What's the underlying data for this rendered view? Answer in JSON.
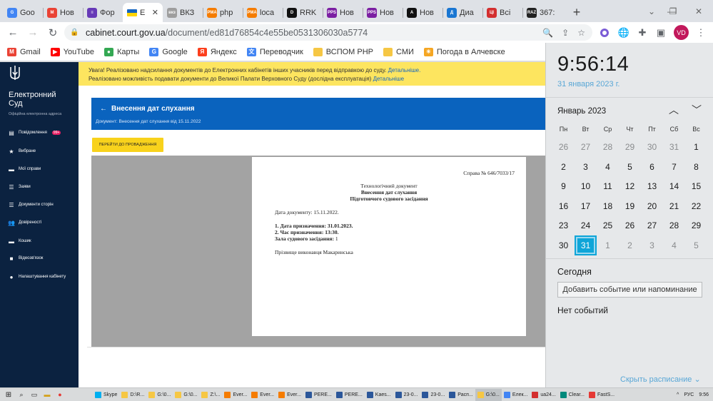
{
  "browser": {
    "tabs": [
      {
        "label": "Goo",
        "icon": "google-icon",
        "color": "#4285f4",
        "glyph": "G"
      },
      {
        "label": "Нов",
        "icon": "gmail-icon",
        "color": "#ea4335",
        "glyph": "M"
      },
      {
        "label": "Фор",
        "icon": "forms-icon",
        "color": "#673ab7",
        "glyph": "≡"
      },
      {
        "label": "Е",
        "icon": "ukraine-flag-icon",
        "color": "#ffd500",
        "glyph": "",
        "active": true
      },
      {
        "label": "ВКЗ",
        "icon": "vkz-icon",
        "color": "#9e9e9e",
        "glyph": "вкз"
      },
      {
        "label": "php",
        "icon": "pma-icon",
        "color": "#f57c00",
        "glyph": "PMA"
      },
      {
        "label": "loca",
        "icon": "pma-icon",
        "color": "#f57c00",
        "glyph": "PMA"
      },
      {
        "label": "RRK",
        "icon": "rrk-icon",
        "color": "#111111",
        "glyph": "D"
      },
      {
        "label": "Нов",
        "icon": "pps-icon",
        "color": "#7b1fa2",
        "glyph": "PPS"
      },
      {
        "label": "Нов",
        "icon": "pps-icon",
        "color": "#7b1fa2",
        "glyph": "PPS"
      },
      {
        "label": "Нов",
        "icon": "a-icon",
        "color": "#111111",
        "glyph": "A"
      },
      {
        "label": "Диа",
        "icon": "d-icon",
        "color": "#1976d2",
        "glyph": "Д"
      },
      {
        "label": "Всі",
        "icon": "flag-icon",
        "color": "#d32f2f",
        "glyph": "ЦІ"
      },
      {
        "label": "367:",
        "icon": "raz-icon",
        "color": "#222222",
        "glyph": "RAZ"
      }
    ],
    "new_tab": "+",
    "url_domain": "cabinet.court.gov.ua",
    "url_path": "/document/ed81d76854c4e55be0531306030a5774",
    "avatar": "VD"
  },
  "bookmarks": [
    {
      "label": "Gmail",
      "icon": "gmail-icon",
      "color": "#ea4335",
      "glyph": "M"
    },
    {
      "label": "YouTube",
      "icon": "youtube-icon",
      "color": "#ff0000",
      "glyph": "▶"
    },
    {
      "label": "Карты",
      "icon": "maps-icon",
      "color": "#34a853",
      "glyph": "●"
    },
    {
      "label": "Google",
      "icon": "google-icon",
      "color": "#4285f4",
      "glyph": "G"
    },
    {
      "label": "Яндекс",
      "icon": "yandex-icon",
      "color": "#fc3f1d",
      "glyph": "Я"
    },
    {
      "label": "Переводчик",
      "icon": "translate-icon",
      "color": "#4285f4",
      "glyph": "文"
    },
    {
      "label": "ВСПОМ PHP",
      "icon": "folder-icon",
      "color": "#f6c744",
      "glyph": ""
    },
    {
      "label": "СМИ",
      "icon": "folder-icon",
      "color": "#f6c744",
      "glyph": ""
    },
    {
      "label": "Погода в Алчевске",
      "icon": "weather-icon",
      "color": "#f5a623",
      "glyph": "☀"
    }
  ],
  "sidebar": {
    "brand_line1": "Електронний",
    "brand_line2": "Суд",
    "brand_sub": "Офіційна електронна адреса",
    "items": [
      {
        "label": "Повідомлення",
        "icon": "messages-icon",
        "glyph": "▤",
        "badge": "99+"
      },
      {
        "label": "Вибране",
        "icon": "star-icon",
        "glyph": "★"
      },
      {
        "label": "Мої справи",
        "icon": "folder-icon",
        "glyph": "▬"
      },
      {
        "label": "Заяви",
        "icon": "list-icon",
        "glyph": "☰"
      },
      {
        "label": "Документи сторін",
        "icon": "documents-icon",
        "glyph": "☰"
      },
      {
        "label": "Довіреності",
        "icon": "users-icon",
        "glyph": "👥"
      },
      {
        "label": "Кошик",
        "icon": "cart-icon",
        "glyph": "▬"
      },
      {
        "label": "Відеозв'язок",
        "icon": "video-icon",
        "glyph": "■"
      },
      {
        "label": "Налаштування кабінету",
        "icon": "user-settings-icon",
        "glyph": "●"
      }
    ]
  },
  "main": {
    "notice_line1": "Увага! Реалізовано надсилання документів до Електронних кабінетів інших учасників перед відправкою до суду.",
    "notice_line1_link": "Детальніше.",
    "notice_line2": "Реалізовано можливість подавати документи до Великої Палати Верховного Суду (дослідна експлуатація)",
    "notice_line2_link": "Детальніше",
    "header_title": "Внесення дат слухання",
    "header_sub": "Документ: Внесення дат слухання від 15.11.2022",
    "goto_button": "ПЕРЕЙТИ ДО ПРОВАДЖЕННЯ"
  },
  "document": {
    "case_no": "Справа № 646/7033/17",
    "title1": "Технологічний документ",
    "title2": "Внесення дат слухання",
    "title3": "Підготовчого судового засідання",
    "doc_date": "Дата документу: 15.11.2022.",
    "item1": "1. Дата призначення: 31.01.2023.",
    "item2": "2. Час призначення: 13:30.",
    "item3_label": "Зала судового засідання:",
    "item3_value": "1",
    "signer": "Прізвище виконавця Макаринська"
  },
  "calendar": {
    "time": "9:56:14",
    "date": "31 января 2023 г.",
    "month": "Январь 2023",
    "weekdays": [
      "Пн",
      "Вт",
      "Ср",
      "Чт",
      "Пт",
      "Сб",
      "Вс"
    ],
    "weeks": [
      [
        "26",
        "27",
        "28",
        "29",
        "30",
        "31",
        "1"
      ],
      [
        "2",
        "3",
        "4",
        "5",
        "6",
        "7",
        "8"
      ],
      [
        "9",
        "10",
        "11",
        "12",
        "13",
        "14",
        "15"
      ],
      [
        "16",
        "17",
        "18",
        "19",
        "20",
        "21",
        "22"
      ],
      [
        "23",
        "24",
        "25",
        "26",
        "27",
        "28",
        "29"
      ],
      [
        "30",
        "31",
        "1",
        "2",
        "3",
        "4",
        "5"
      ]
    ],
    "today_label": "Сегодня",
    "add_event": "Добавить событие или напоминание",
    "no_events": "Нет событий",
    "show_schedule": "Скрыть расписание"
  },
  "taskbar": {
    "items": [
      {
        "label": "Skype",
        "color": "#00aff0"
      },
      {
        "label": "D:\\R...",
        "color": "#f6c744"
      },
      {
        "label": "G:\\0...",
        "color": "#f6c744"
      },
      {
        "label": "G:\\0...",
        "color": "#f6c744"
      },
      {
        "label": "Z:\\...",
        "color": "#f6c744"
      },
      {
        "label": "Ever...",
        "color": "#f57c00"
      },
      {
        "label": "Ever...",
        "color": "#f57c00"
      },
      {
        "label": "Ever...",
        "color": "#f57c00"
      },
      {
        "label": "PERE...",
        "color": "#2b579a"
      },
      {
        "label": "PERE...",
        "color": "#2b579a"
      },
      {
        "label": "Kaes...",
        "color": "#2b579a"
      },
      {
        "label": "23-0...",
        "color": "#2b579a"
      },
      {
        "label": "23-0...",
        "color": "#2b579a"
      },
      {
        "label": "Расп...",
        "color": "#2b579a"
      },
      {
        "label": "G:\\0...",
        "color": "#f6c744"
      },
      {
        "label": "Елек...",
        "color": "#4285f4"
      },
      {
        "label": "ua24...",
        "color": "#d32f2f"
      },
      {
        "label": "Clear...",
        "color": "#00897b"
      },
      {
        "label": "FastS...",
        "color": "#e53935"
      }
    ],
    "lang": "РУС",
    "clock": "9:56"
  }
}
